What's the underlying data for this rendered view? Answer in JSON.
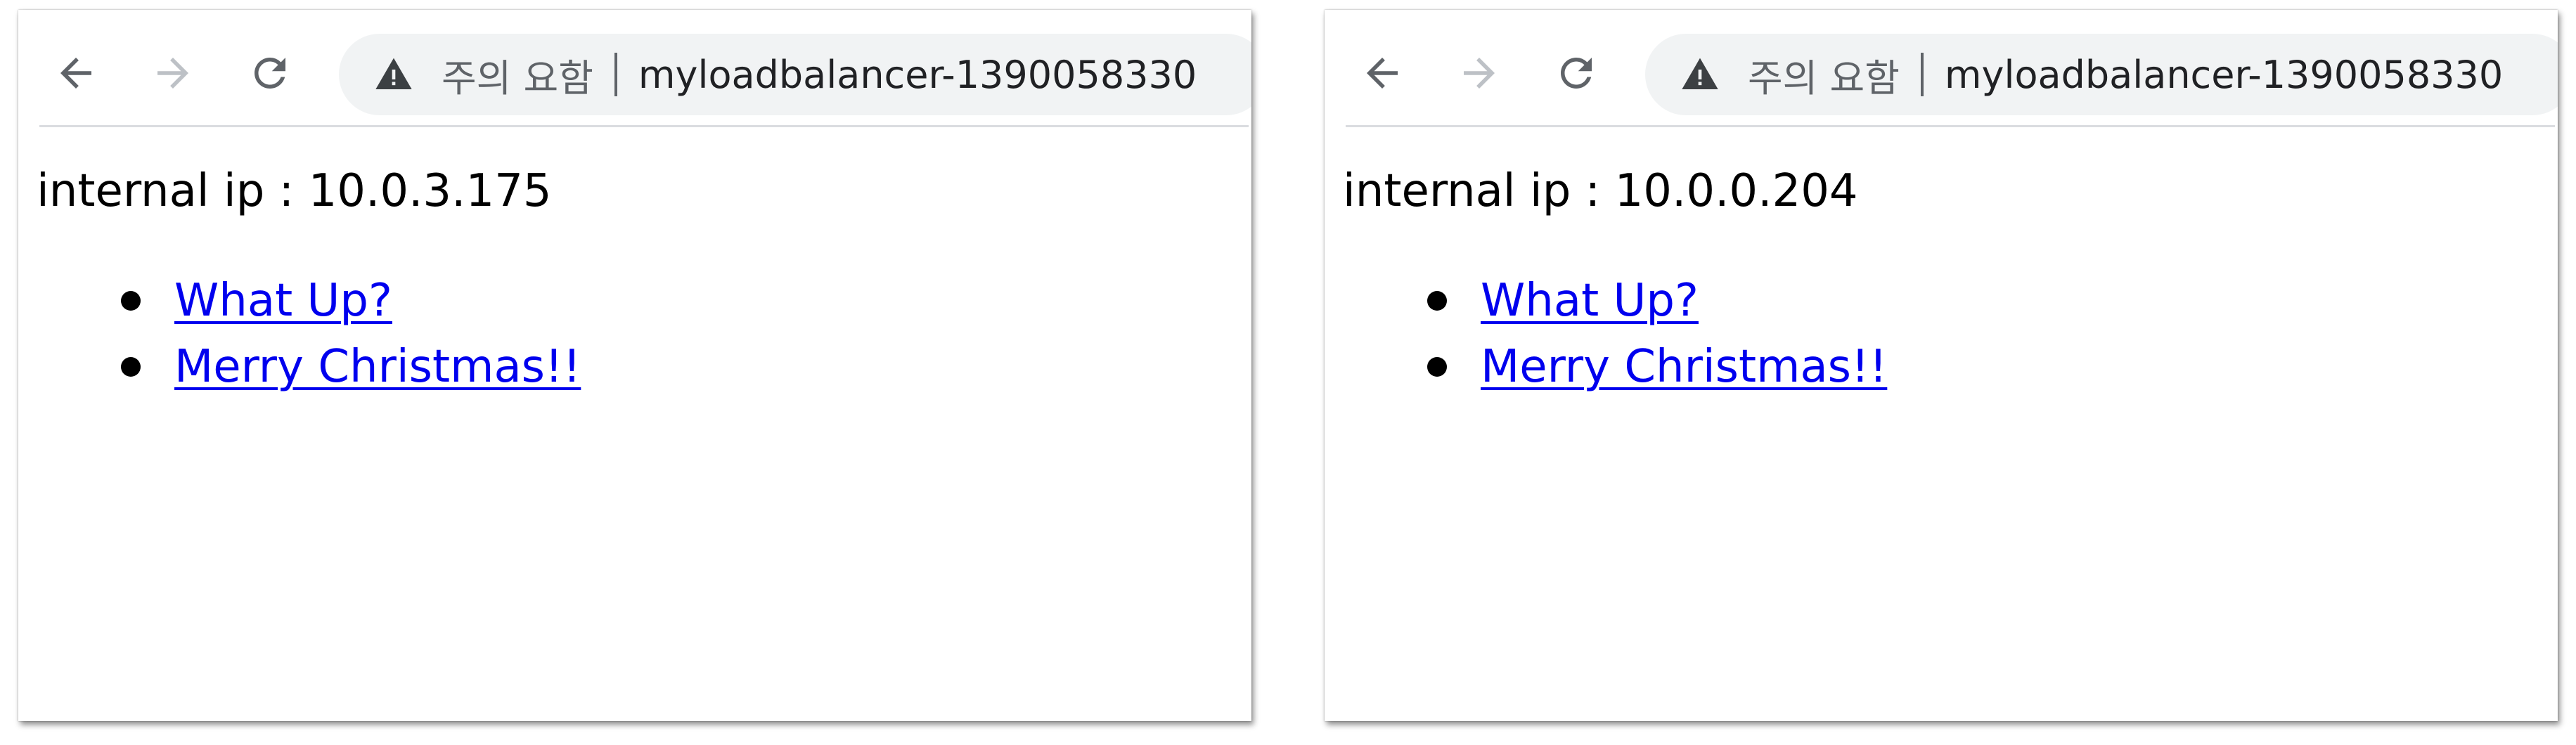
{
  "windows": [
    {
      "toolbar": {
        "back_icon": "arrow-left-icon",
        "forward_icon": "arrow-right-icon",
        "reload_icon": "reload-icon",
        "security_icon": "warning-triangle-icon",
        "security_label": "주의 요함",
        "url": "myloadbalancer-1390058330"
      },
      "content": {
        "ip_text": "internal ip : 10.0.3.175",
        "links": [
          "What Up?",
          "Merry Christmas!!"
        ]
      }
    },
    {
      "toolbar": {
        "back_icon": "arrow-left-icon",
        "forward_icon": "arrow-right-icon",
        "reload_icon": "reload-icon",
        "security_icon": "warning-triangle-icon",
        "security_label": "주의 요함",
        "url": "myloadbalancer-1390058330"
      },
      "content": {
        "ip_text": "internal ip : 10.0.0.204",
        "links": [
          "What Up?",
          "Merry Christmas!!"
        ]
      }
    }
  ],
  "colors": {
    "link": "#0000ee",
    "omnibox_bg": "#f1f3f4",
    "icon_active": "#5f6368",
    "icon_disabled": "#bdc1c6",
    "divider": "#dadce0"
  }
}
